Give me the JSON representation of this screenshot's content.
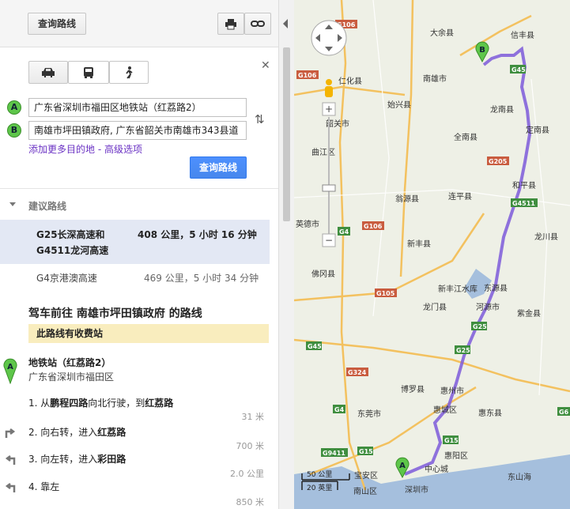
{
  "header": {
    "search_btn": "查询路线"
  },
  "modes": [
    "drive",
    "transit",
    "walk"
  ],
  "start": "广东省深圳市福田区地铁站（红荔路2）",
  "end": "南雄市坪田镇政府, 广东省韶关市南雄市343县道",
  "add_link": "添加更多目的地 - 高级选项",
  "query_btn": "查询路线",
  "suggest_title": "建议路线",
  "routes": [
    {
      "name_line1": "G25长深高速和",
      "name_line2": "G4511龙河高速",
      "info": "408 公里，5 小时 16 分钟"
    },
    {
      "name": "G4京港澳高速",
      "info": "469 公里，5 小时 34 分钟"
    }
  ],
  "dir_title": "驾车前往 南雄市坪田镇政府 的路线",
  "toll_note": "此路线有收费站",
  "start_name": "地铁站（红荔路2）",
  "start_addr": "广东省深圳市福田区",
  "steps": [
    {
      "pre": "1. 从",
      "b1": "鹏程四路",
      "mid": "向北行驶，到",
      "b2": "红荔路",
      "dist": "31 米"
    },
    {
      "pre": "2. 向右转，进入",
      "b1": "红荔路",
      "dist": "700 米"
    },
    {
      "pre": "3. 向左转，进入",
      "b1": "彩田路",
      "dist": "2.0 公里"
    },
    {
      "pre": "4. 靠左",
      "dist": "850 米"
    }
  ],
  "markers": {
    "a": "A",
    "b": "B"
  },
  "scale": {
    "km": "50 公里",
    "mi": "20 英里"
  },
  "map_labels": {
    "places": [
      "大余县",
      "信丰县",
      "仁化县",
      "南雄市",
      "始兴县",
      "龙南县",
      "韶关市",
      "定南县",
      "全南县",
      "曲江区",
      "连平县",
      "和平县",
      "翁源县",
      "龙川县",
      "英德市",
      "新丰县",
      "佛冈县",
      "新丰江水库",
      "东源县",
      "龙门县",
      "河源市",
      "紫金县",
      "博罗县",
      "惠州市",
      "惠城区",
      "惠东县",
      "东莞市",
      "宝安区",
      "深圳市",
      "惠阳区",
      "南山区",
      "中心城",
      "东山海"
    ],
    "roads": [
      "G106",
      "G105",
      "G45",
      "G4",
      "G4511",
      "G205",
      "G25",
      "G15",
      "G324",
      "G9411",
      "G6"
    ]
  },
  "colors": {
    "route": "#7d5bd9",
    "blue": "#4787ed",
    "pin": "#5ec64a"
  }
}
